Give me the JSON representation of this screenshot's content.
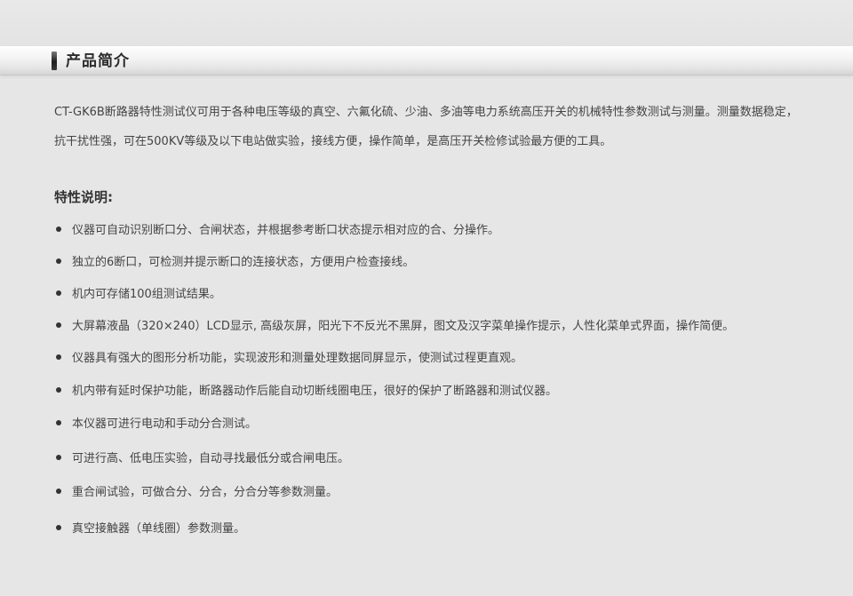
{
  "header": {
    "title": "产品简介"
  },
  "intro": {
    "text": "CT-GK6B断路器特性测试仪可用于各种电压等级的真空、六氟化硫、少油、多油等电力系统高压开关的机械特性参数测试与测量。测量数据稳定，抗干扰性强，可在500KV等级及以下电站做实验，接线方便，操作简单，是高压开关检修试验最方便的工具。"
  },
  "features": {
    "heading": "特性说明:",
    "items": [
      "仪器可自动识别断口分、合闸状态，并根据参考断口状态提示相对应的合、分操作。",
      "独立的6断口，可检测并提示断口的连接状态，方便用户检查接线。",
      "机内可存储100组测试结果。",
      "大屏幕液晶（320×240）LCD显示, 高级灰屏，阳光下不反光不黑屏，图文及汉字菜单操作提示，人性化菜单式界面，操作简便。",
      "仪器具有强大的图形分析功能，实现波形和测量处理数据同屏显示，使测试过程更直观。",
      "机内带有延时保护功能，断路器动作后能自动切断线圈电压，很好的保护了断路器和测试仪器。",
      "本仪器可进行电动和手动分合测试。",
      "可进行高、低电压实验，自动寻找最低分或合闸电压。",
      "重合闸试验，可做合分、分合，分合分等参数测量。",
      "真空接触器（单线圈）参数测量。"
    ]
  }
}
